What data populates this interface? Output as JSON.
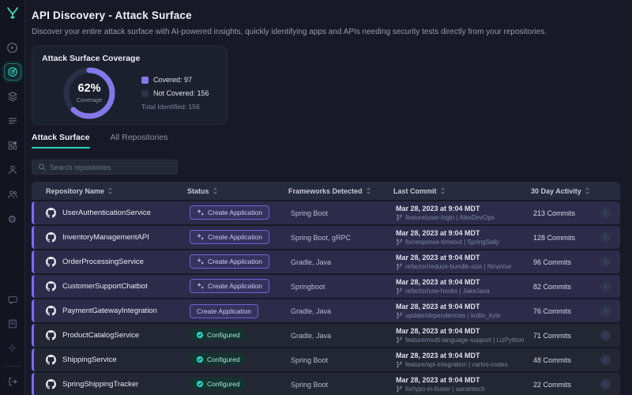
{
  "app": {
    "title": "API Discovery - Attack Surface",
    "subtitle": "Discover your entire attack surface with AI-powered insights, quickly identifying apps and APIs needing security tests directly from your repositories."
  },
  "colors": {
    "accent_teal": "#2dd4bf",
    "accent_purple": "#8478e8",
    "covered_color": "#8478e8",
    "not_covered_color": "#2e3247",
    "row_highlight": "#2c2c4a",
    "row_dark": "#232633"
  },
  "sidebar": {
    "icons": [
      "brand-logo",
      "play-circle-icon",
      "api-discovery-radar-icon",
      "layers-icon",
      "list-icon",
      "grid-apps-icon",
      "user-icon",
      "users-icon",
      "gear-icon",
      "chat-icon",
      "docs-book-icon",
      "spark-icon",
      "logout-icon"
    ]
  },
  "coverage_card": {
    "title": "Attack Surface Coverage",
    "percent": "62%",
    "percent_label": "Coverage",
    "legend": [
      {
        "label": "Covered: 97",
        "color": "#8478e8"
      },
      {
        "label": "Not Covered: 156",
        "color": "#2e3247"
      }
    ],
    "total": "Total Identified: 156"
  },
  "chart_data": {
    "type": "pie",
    "title": "Attack Surface Coverage",
    "center_label": "62% Coverage",
    "percent_covered": 62,
    "segments": [
      {
        "label": "Covered",
        "value": 97,
        "color": "#8478e8"
      },
      {
        "label": "Not Covered",
        "value": 156,
        "color": "#2e3247"
      }
    ],
    "total_identified": 156,
    "legend_position": "right"
  },
  "tabs": [
    {
      "label": "Attack Surface",
      "active": true
    },
    {
      "label": "All Repositories",
      "active": false
    }
  ],
  "search": {
    "placeholder": "Search repositories"
  },
  "table": {
    "columns": [
      "Repository Name",
      "Status",
      "Frameworks Detected",
      "Last Commit",
      "30 Day Activity"
    ],
    "rows": [
      {
        "name": "UserAuthenticationService",
        "status": "Create Application",
        "status_type": "create",
        "sparkle": true,
        "frameworks": "Spring Boot",
        "commit_date": "Mar 28, 2023 at 9:04 MDT",
        "commit_branch": "feature/user-login | AlexDevOps",
        "activity": "213 Commits",
        "highlight": true
      },
      {
        "name": "InventoryManagementAPI",
        "status": "Create Application",
        "status_type": "create",
        "sparkle": true,
        "frameworks": "Spring Boot, gRPC",
        "commit_date": "Mar 28, 2023 at 9:04 MDT",
        "commit_branch": "fix/response-timeout | SpringSally",
        "activity": "128 Commits",
        "highlight": true
      },
      {
        "name": "OrderProcessingService",
        "status": "Create Application",
        "status_type": "create",
        "sparkle": true,
        "frameworks": "Gradle, Java",
        "commit_date": "Mar 28, 2023 at 9:04 MDT",
        "commit_branch": "refactor/reduce-bundle-size | NinaVue",
        "activity": "96 Commits",
        "highlight": true
      },
      {
        "name": "CustomerSupportChatbot",
        "status": "Create Application",
        "status_type": "create",
        "sparkle": true,
        "frameworks": "Springboot",
        "commit_date": "Mar 28, 2023 at 9:04 MDT",
        "commit_branch": "refactor/use-hooks | JakeJava",
        "activity": "82 Commits",
        "highlight": true
      },
      {
        "name": "PaymentGatewayIntegration",
        "status": "Create Application",
        "status_type": "create",
        "sparkle": false,
        "frameworks": "Gradle, Java",
        "commit_date": "Mar 28, 2023 at 9:04 MDT",
        "commit_branch": "update/dependencies | kotlin_kyle",
        "activity": "76 Commits",
        "highlight": true
      },
      {
        "name": "ProductCatalogService",
        "status": "Configured",
        "status_type": "configured",
        "sparkle": false,
        "frameworks": "Gradle, Java",
        "commit_date": "Mar 28, 2023 at 9:04 MDT",
        "commit_branch": "feature/multi-language-support | LizPython",
        "activity": "71 Commits",
        "highlight": false
      },
      {
        "name": "ShippingService",
        "status": "Configured",
        "status_type": "configured",
        "sparkle": false,
        "frameworks": "Spring Boot",
        "commit_date": "Mar 28, 2023 at 9:04 MDT",
        "commit_branch": "feature/api-integration | carlos-codes",
        "activity": "48 Commits",
        "highlight": false
      },
      {
        "name": "SpringShippingTracker",
        "status": "Configured",
        "status_type": "configured",
        "sparkle": false,
        "frameworks": "Spring Boot",
        "commit_date": "Mar 28, 2023 at 9:04 MDT",
        "commit_branch": "fix/typo-in-footer | saraintech",
        "activity": "22 Commits",
        "highlight": false
      }
    ]
  }
}
